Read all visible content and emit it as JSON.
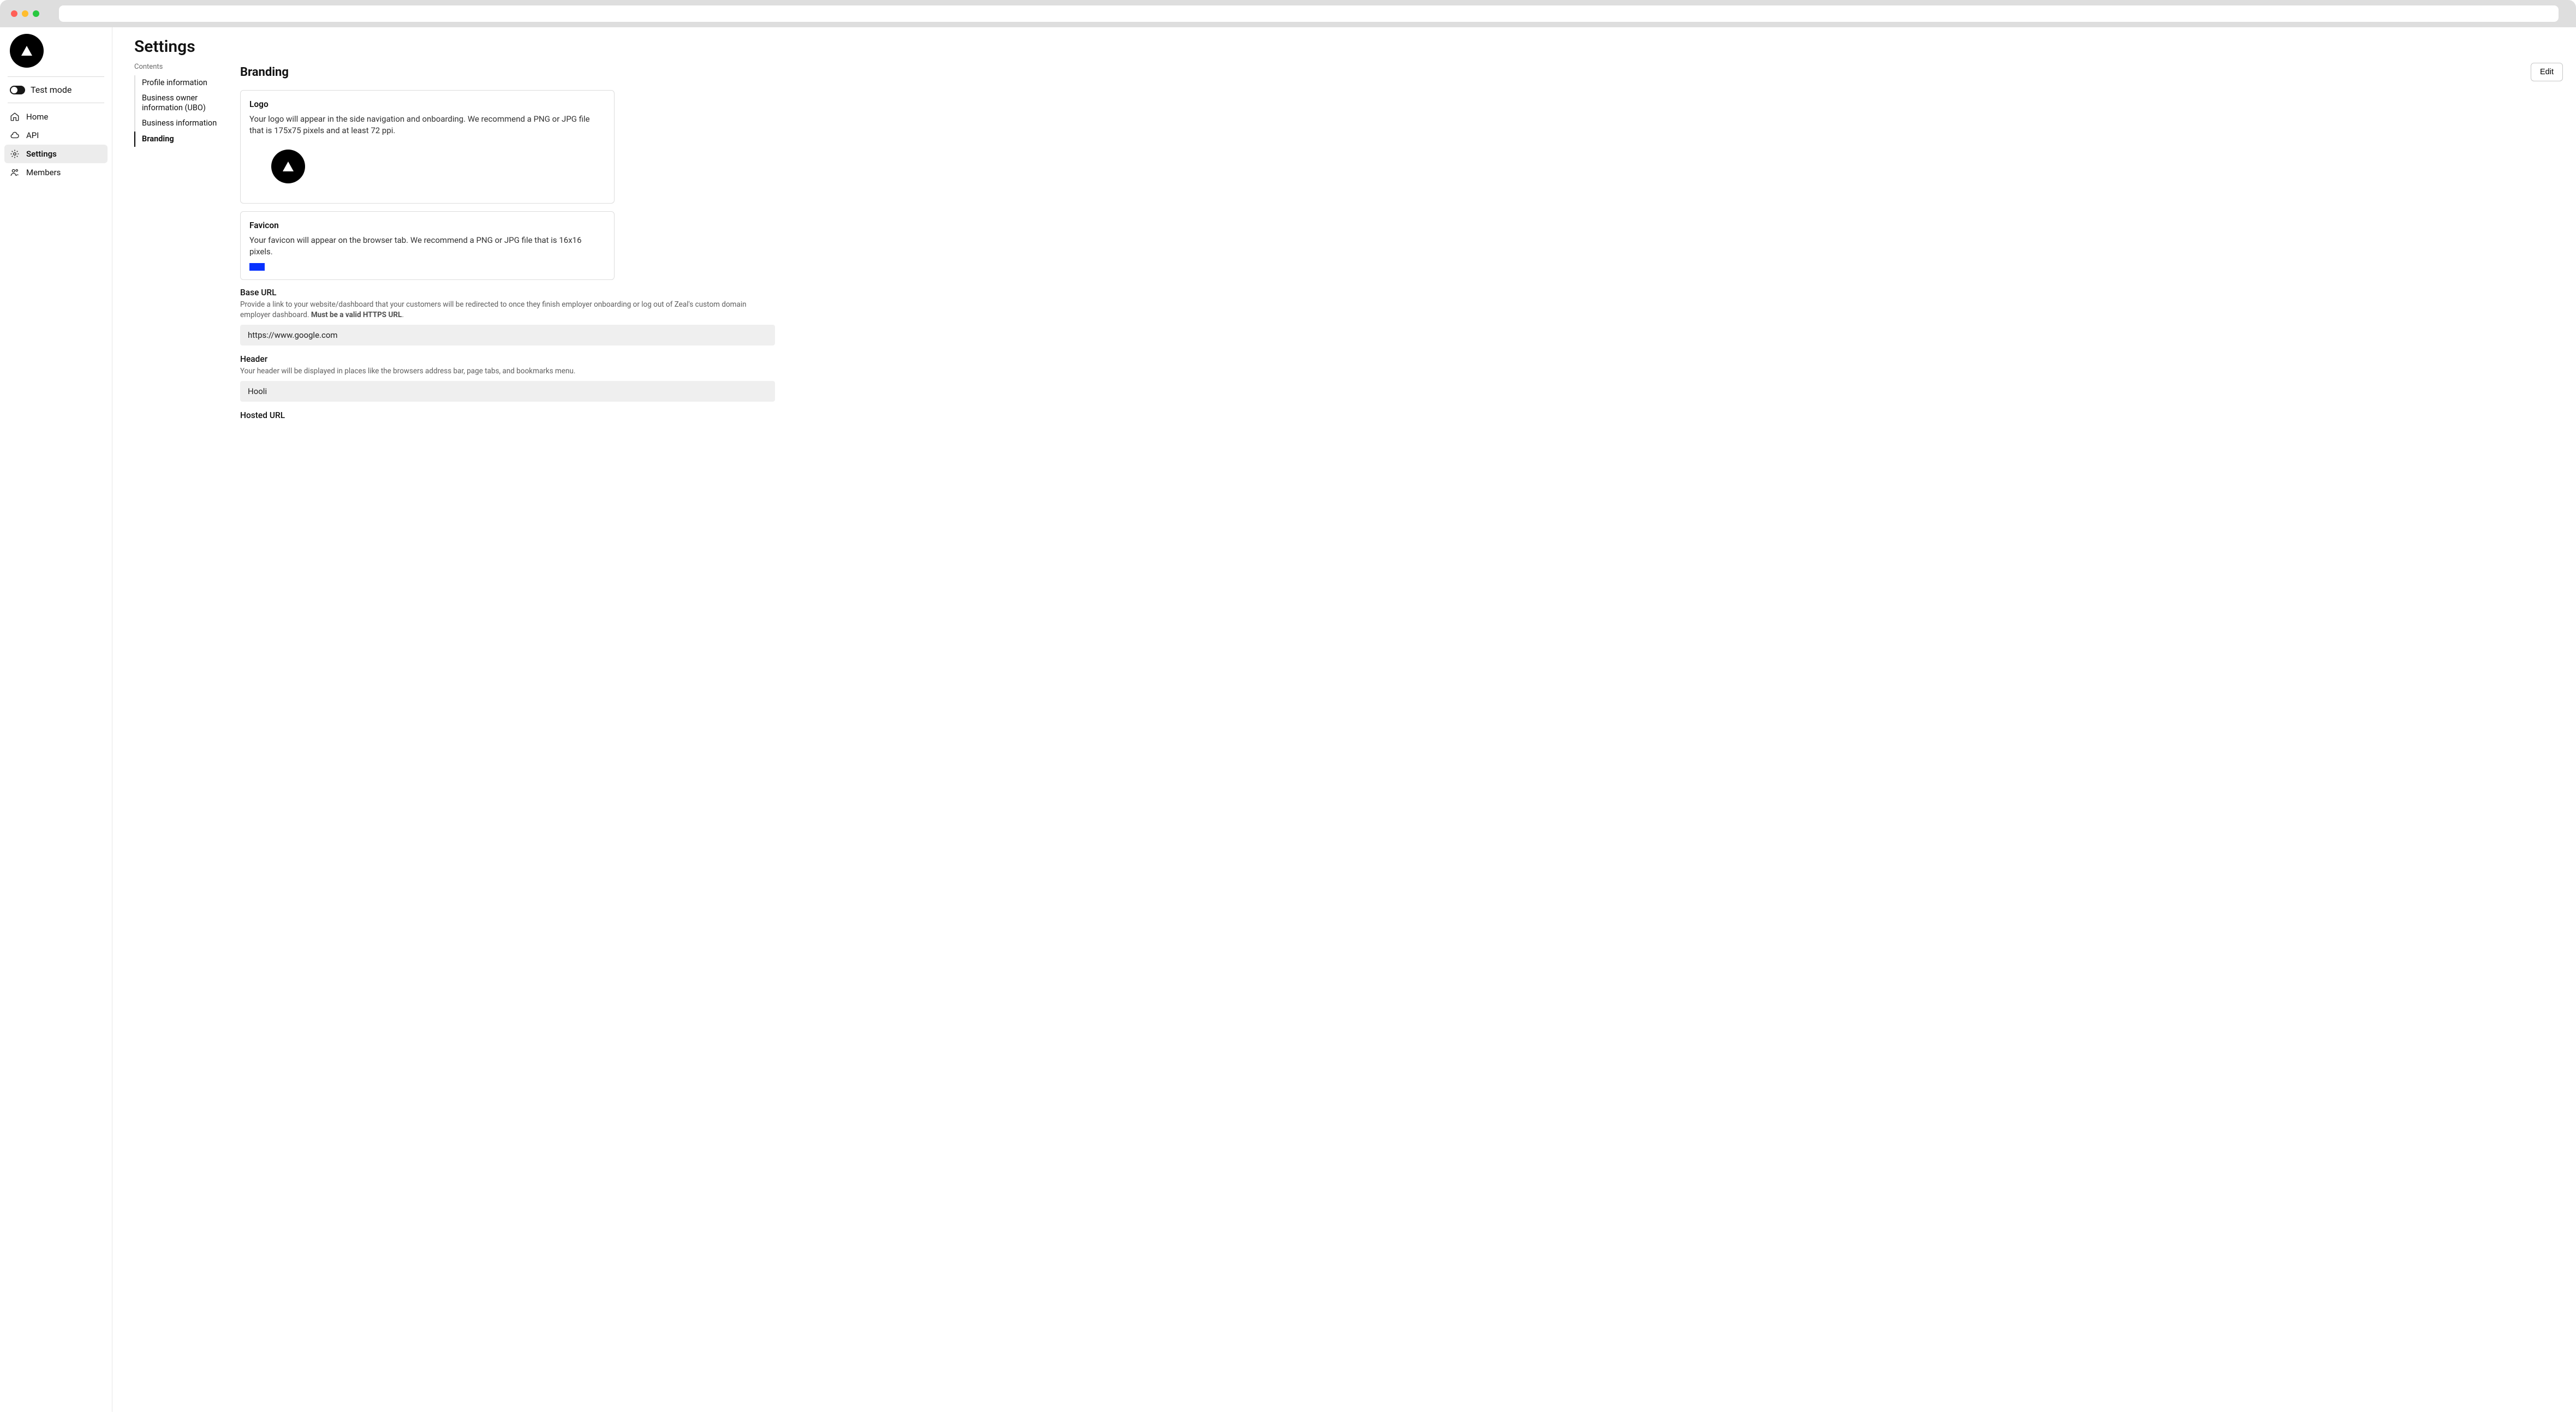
{
  "sidebar": {
    "test_mode_label": "Test mode",
    "items": [
      {
        "icon": "home",
        "label": "Home"
      },
      {
        "icon": "cloud",
        "label": "API"
      },
      {
        "icon": "gear",
        "label": "Settings"
      },
      {
        "icon": "people",
        "label": "Members"
      }
    ],
    "active_index": 2
  },
  "page": {
    "title": "Settings",
    "contents_heading": "Contents",
    "contents": [
      "Profile information",
      "Business owner information (UBO)",
      "Business information",
      "Branding"
    ],
    "contents_active_index": 3
  },
  "branding": {
    "section_title": "Branding",
    "edit_label": "Edit",
    "logo": {
      "title": "Logo",
      "description": "Your logo will appear in the side navigation and onboarding. We recommend a PNG or JPG file that is 175x75 pixels and at least 72 ppi."
    },
    "favicon": {
      "title": "Favicon",
      "description": "Your favicon will appear on the browser tab. We recommend a PNG or JPG file that is 16x16 pixels."
    },
    "base_url": {
      "label": "Base URL",
      "help_pre": "Provide a link to your website/dashboard that your customers will be redirected to once they finish employer onboarding or log out of Zeal's custom domain employer dashboard. ",
      "help_strong": "Must be a valid HTTPS URL",
      "help_post": ".",
      "value": "https://www.google.com"
    },
    "header": {
      "label": "Header",
      "help": "Your header will be displayed in places like the browsers address bar, page tabs, and bookmarks menu.",
      "value": "Hooli"
    },
    "hosted_url": {
      "label": "Hosted URL"
    }
  }
}
